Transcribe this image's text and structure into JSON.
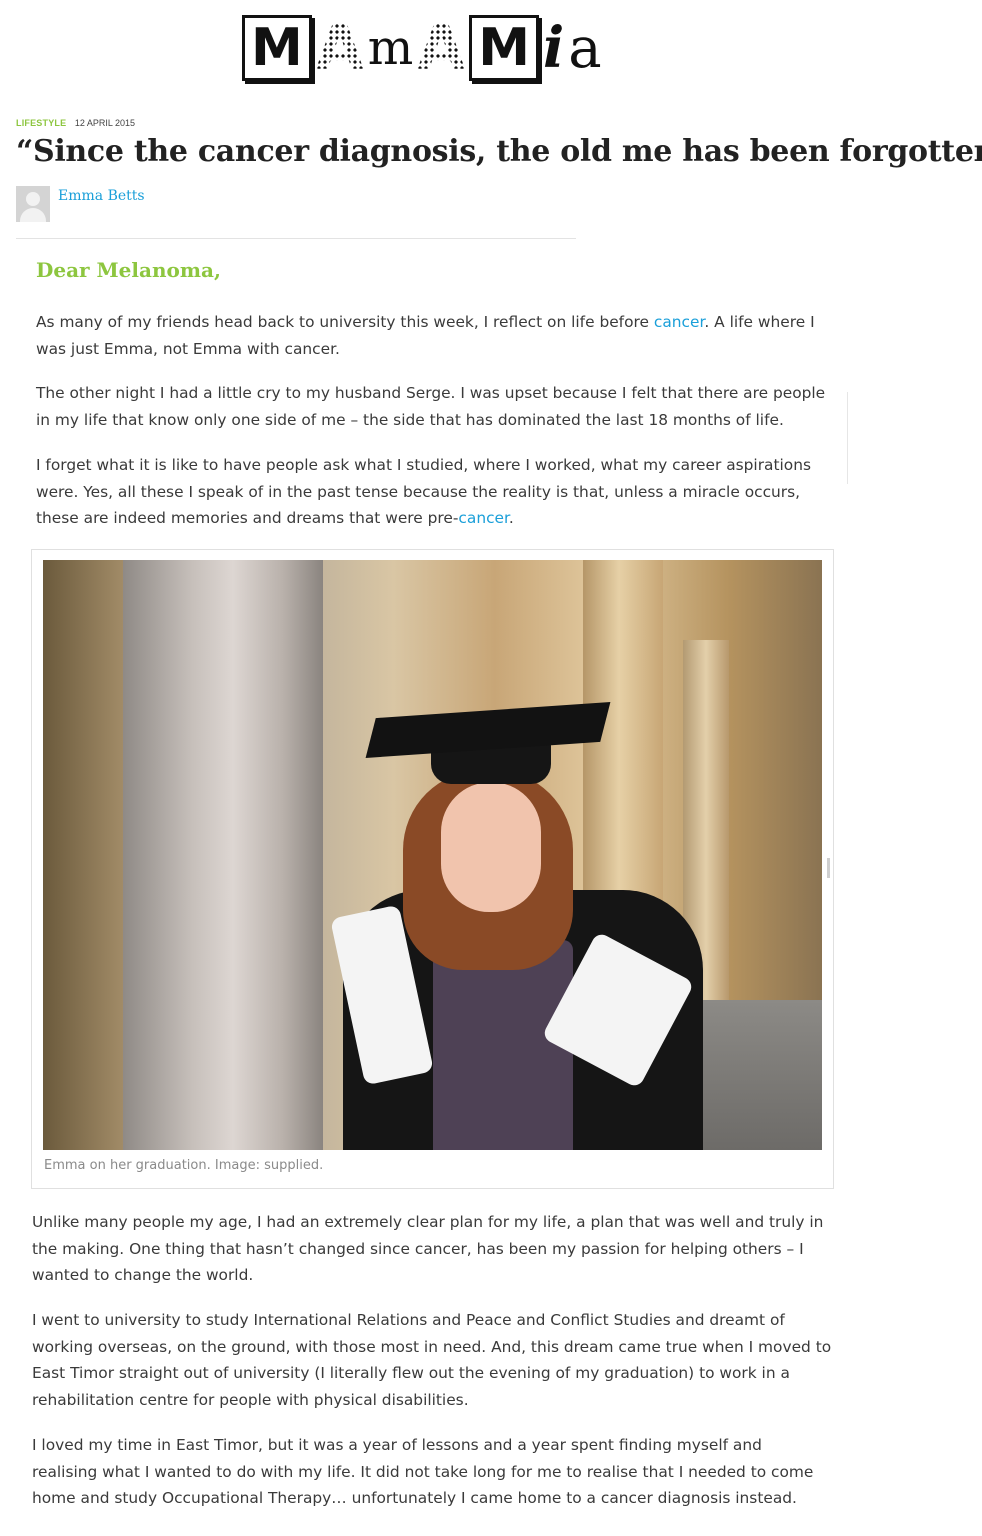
{
  "logo": {
    "letters": [
      "M",
      "A",
      "m",
      "A",
      "M",
      "i",
      "a"
    ]
  },
  "article": {
    "category": "LIFESTYLE",
    "date": "12 APRIL 2015",
    "headline": "“Since the cancer diagnosis, the old me has been forgotten.”",
    "author": "Emma Betts",
    "salutation": "Dear Melanoma,",
    "p1": {
      "a": "As many of my friends head back to university this week, I reflect on life before ",
      "link": "cancer",
      "b": ". A life where I was just Emma, not Emma with cancer."
    },
    "p2": "The other night I had a little cry to my husband Serge. I was upset because I felt that there are people in my life that know only one side of me – the side that has dominated the last 18 months of life.",
    "p3": {
      "a": "I forget what it is like to have people ask what I studied, where I worked, what my career aspirations were. Yes, all these I speak of in the past tense because the reality is that, unless a miracle occurs, these are indeed memories and dreams that were pre-",
      "link": "cancer",
      "b": "."
    },
    "image_caption": "Emma on her graduation. Image: supplied.",
    "p4": "Unlike many people my age, I had an extremely clear plan for my life, a plan that was well and truly in the making. One thing that hasn’t changed since cancer, has been my passion for helping others – I wanted to change the world.",
    "p5": "I went to university to study International Relations and Peace and Conflict Studies and dreamt of working overseas, on the ground, with those most in need. And, this dream came true when I moved to East Timor straight out of university (I literally flew out the evening of my graduation) to work in a rehabilitation centre for people with physical disabilities.",
    "p6": "I loved my time in East Timor, but it was a year of lessons and a year spent finding myself and realising what I wanted to do with my life. It did not take long for me to realise that I needed to come home and study Occupational Therapy… unfortunately I came home to a cancer diagnosis instead."
  },
  "colors": {
    "accent_green": "#8dc63f",
    "link_blue": "#1a9fd9"
  }
}
